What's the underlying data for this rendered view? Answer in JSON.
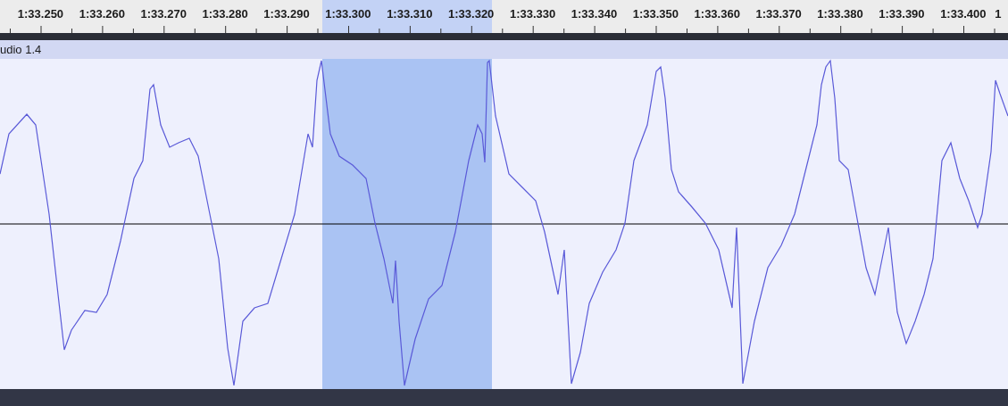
{
  "ruler": {
    "labels": [
      "1:33.250",
      "1:33.260",
      "1:33.270",
      "1:33.280",
      "1:33.290",
      "1:33.300",
      "1:33.310",
      "1:33.320",
      "1:33.330",
      "1:33.340",
      "1:33.350",
      "1:33.360",
      "1:33.370",
      "1:33.380",
      "1:33.390",
      "1:33.400",
      "1"
    ]
  },
  "track": {
    "name": "udio 1.4"
  }
}
